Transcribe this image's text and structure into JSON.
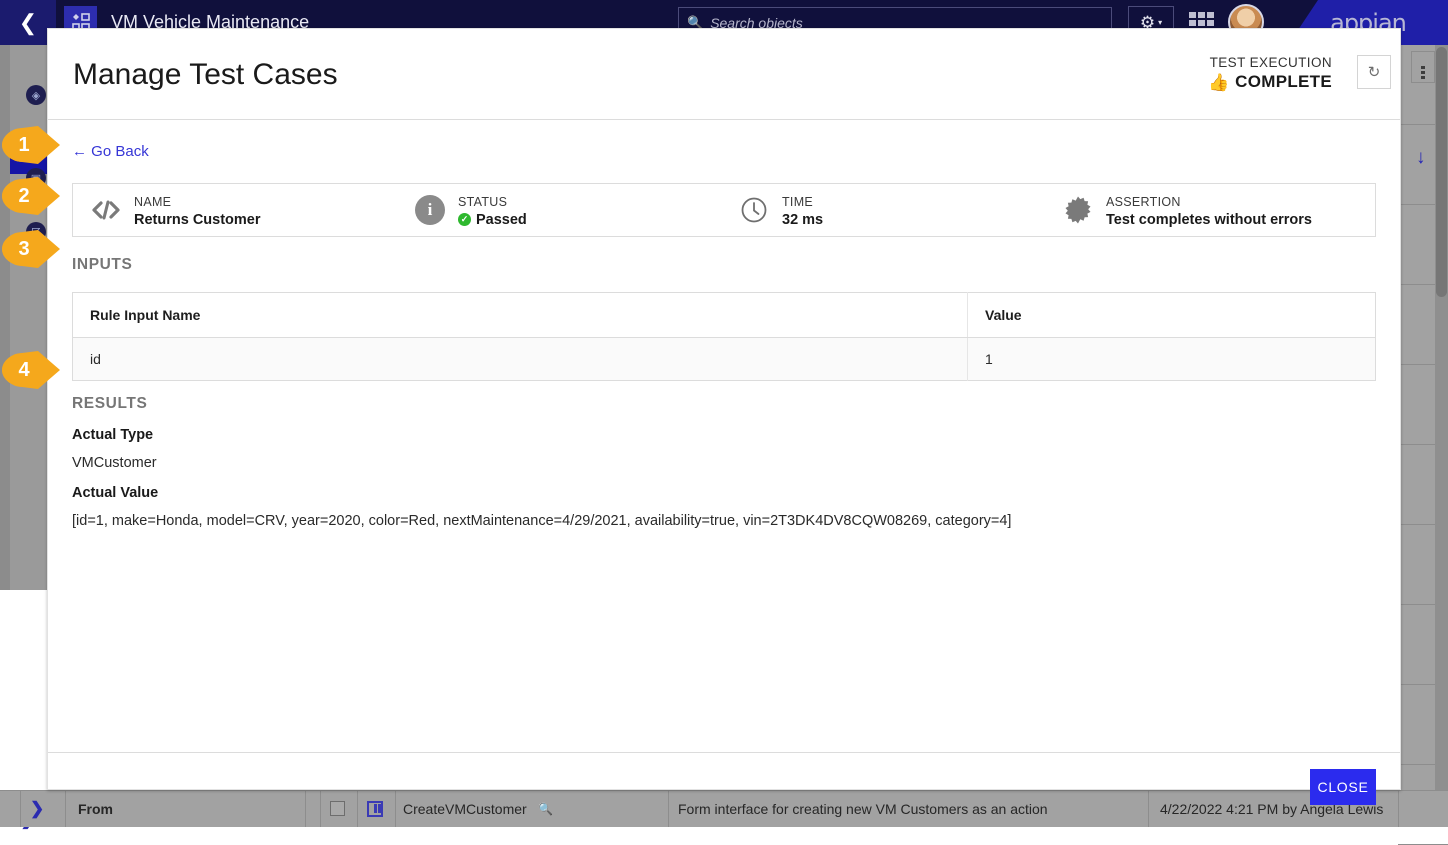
{
  "topnav": {
    "back_icon": "chevron-left-icon",
    "app_tile_icon": "app-grid-icon",
    "app_title": "VM Vehicle Maintenance",
    "search": {
      "icon": "search-objects-icon",
      "placeholder": "Search objects",
      "value": ""
    },
    "gear_label": "⚙",
    "gear_caret": "▾",
    "grid_icon": "apps-grid-icon",
    "avatar_name": "user-avatar",
    "brand": "appian"
  },
  "background": {
    "rail_icons": [
      "compass-icon",
      "objects-icon",
      "monitor-icon"
    ],
    "collapse_chevron": "❯",
    "bottom_row": {
      "from_label": "From",
      "object_name": "CreateVMCustomer",
      "description": "Form interface for creating new VM Customers as an action",
      "modified": "4/22/2022 4:21 PM by Angela Lewis"
    },
    "download_arrow": "↓"
  },
  "modal": {
    "title": "Manage Test Cases",
    "execution": {
      "label": "TEST EXECUTION",
      "status": "COMPLETE",
      "thumb_icon": "thumbs-up-icon"
    },
    "refresh_icon": "↻",
    "go_back": "← Go Back",
    "info_bar": [
      {
        "icon": "code-brackets-icon",
        "label": "NAME",
        "value": "Returns Customer",
        "check": false
      },
      {
        "icon": "info-circle-icon",
        "label": "STATUS",
        "value": "Passed",
        "check": true
      },
      {
        "icon": "clock-icon",
        "label": "TIME",
        "value": "32 ms",
        "check": false
      },
      {
        "icon": "gear-burst-icon",
        "label": "ASSERTION",
        "value": "Test completes without errors",
        "check": false
      }
    ],
    "inputs": {
      "heading": "INPUTS",
      "columns": [
        "Rule Input Name",
        "Value"
      ],
      "rows": [
        [
          "id",
          "1"
        ]
      ]
    },
    "results": {
      "heading": "RESULTS",
      "actual_type_label": "Actual Type",
      "actual_type_value": "VMCustomer",
      "actual_value_label": "Actual Value",
      "actual_value_value": "[id=1, make=Honda, model=CRV, year=2020, color=Red, nextMaintenance=4/29/2021, availability=true, vin=2T3DK4DV8CQW08269, category=4]"
    },
    "close_label": "CLOSE"
  },
  "callouts": [
    {
      "num": "1"
    },
    {
      "num": "2"
    },
    {
      "num": "3"
    },
    {
      "num": "4"
    }
  ],
  "colors": {
    "nav_bg": "#10103c",
    "brand_blue": "#1f1fa8",
    "link_blue": "#3636d6",
    "primary_button": "#2b2bee",
    "pass_green": "#2eb82e",
    "callout_orange": "#f5a81c",
    "section_gray": "#767676"
  }
}
